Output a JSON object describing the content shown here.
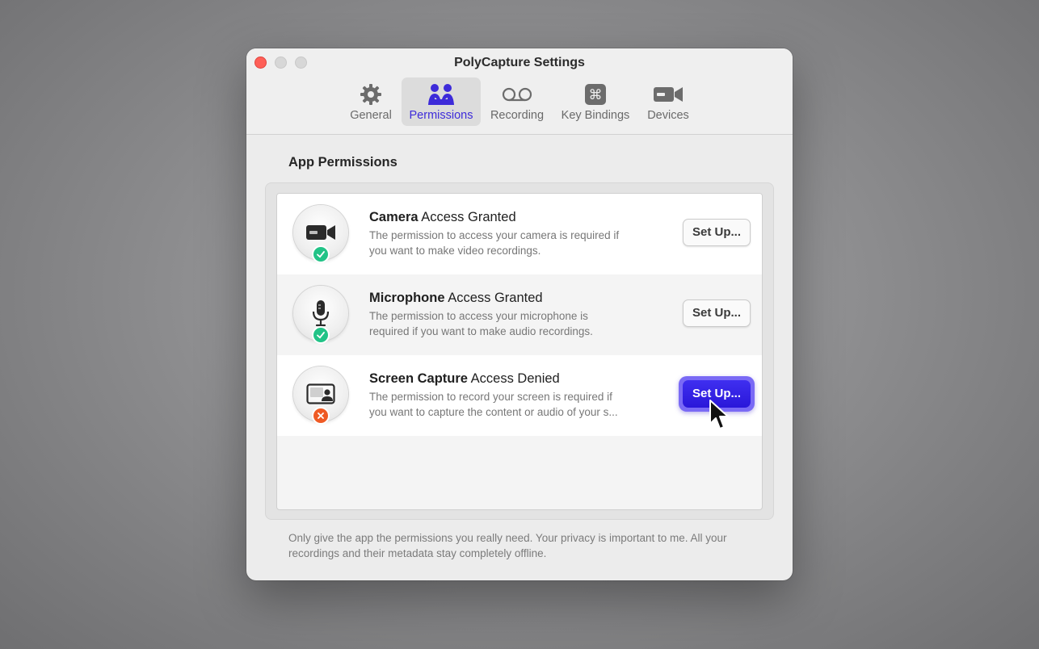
{
  "window": {
    "title": "PolyCapture Settings"
  },
  "tabs": [
    {
      "label": "General",
      "icon": "gear-icon"
    },
    {
      "label": "Permissions",
      "icon": "people-icon",
      "active": true
    },
    {
      "label": "Recording",
      "icon": "voicemail-icon"
    },
    {
      "label": "Key Bindings",
      "icon": "command-key-icon"
    },
    {
      "label": "Devices",
      "icon": "video-camera-icon"
    }
  ],
  "section": {
    "title": "App Permissions"
  },
  "permissions": [
    {
      "name": "Camera",
      "status": "Access Granted",
      "granted": true,
      "description_lines": [
        "The permission to access your camera is required if",
        "you want to make video recordings."
      ],
      "button": "Set Up..."
    },
    {
      "name": "Microphone",
      "status": "Access Granted",
      "granted": true,
      "description_lines": [
        "The permission to access your microphone is",
        "required if you want to make audio recordings."
      ],
      "button": "Set Up..."
    },
    {
      "name": "Screen Capture",
      "status": "Access Denied",
      "granted": false,
      "description_lines": [
        "The permission to record your screen is required if",
        "you want to capture the content or audio of your s..."
      ],
      "button": "Set Up..."
    }
  ],
  "footnote": "Only give the app the permissions you really need. Your privacy is important to me. All your recordings and their metadata stay completely offline.",
  "colors": {
    "accent": "#3d2bd9",
    "granted": "#22c387",
    "denied": "#ef5a24",
    "close": "#fe5f57"
  }
}
